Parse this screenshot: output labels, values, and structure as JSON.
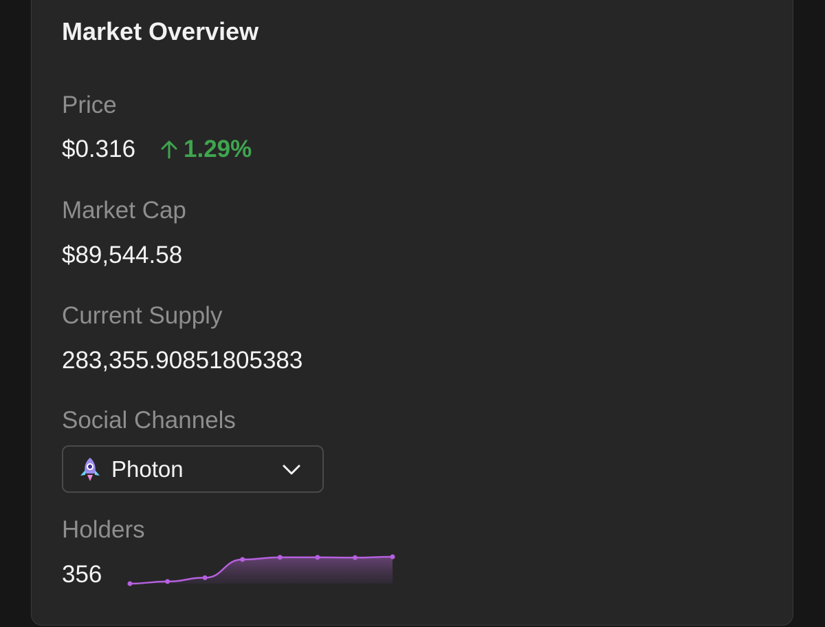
{
  "card": {
    "title": "Market Overview"
  },
  "price": {
    "label": "Price",
    "value": "$0.316",
    "change": "1.29%",
    "change_direction_icon": "arrow-up-icon",
    "change_color": "#3fa54f"
  },
  "market_cap": {
    "label": "Market Cap",
    "value": "$89,544.58"
  },
  "supply": {
    "label": "Current Supply",
    "value": "283,355.90851805383"
  },
  "social": {
    "label": "Social Channels",
    "selected": "Photon",
    "icon": "rocket-icon"
  },
  "holders": {
    "label": "Holders",
    "value": "356",
    "sparkline": [
      0.0,
      0.08,
      0.22,
      0.9,
      0.98,
      0.98,
      0.97,
      1.0
    ],
    "sparkline_color": "#b660e0"
  }
}
